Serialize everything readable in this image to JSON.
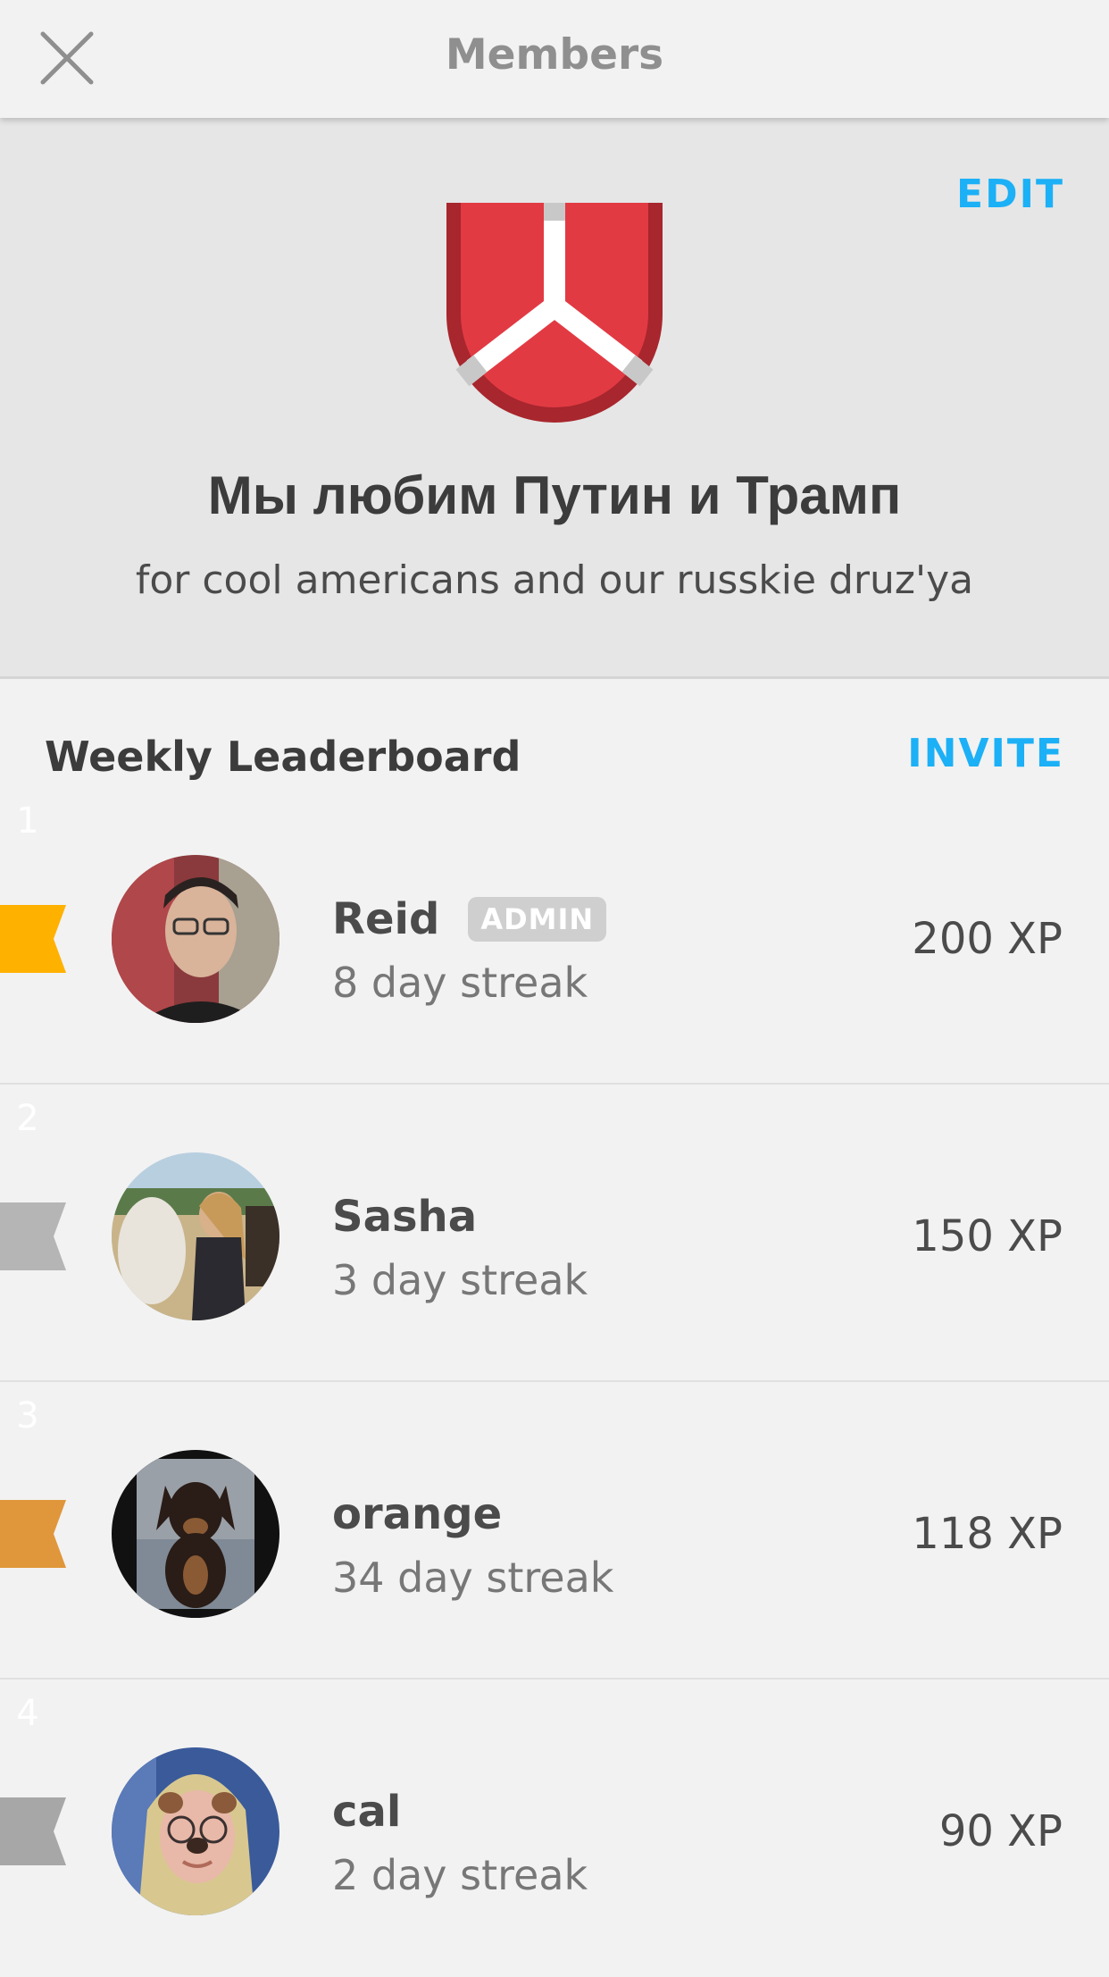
{
  "header": {
    "title": "Members",
    "close_icon": "close-icon"
  },
  "club": {
    "edit_label": "EDIT",
    "name": "Мы любим Путин и Трамп",
    "description": "for cool americans and our russkie druz'ya",
    "shield_icon": "shield-icon",
    "shield_colors": {
      "outer": "#a8262d",
      "inner": "#e23a43",
      "stripe": "#ffffff"
    }
  },
  "leaderboard": {
    "title": "Weekly Leaderboard",
    "invite_label": "INVITE",
    "members": [
      {
        "rank": "1",
        "name": "Reid",
        "badge": "ADMIN",
        "streak": "8 day streak",
        "xp": "200 XP",
        "rank_color": "#ffb100"
      },
      {
        "rank": "2",
        "name": "Sasha",
        "badge": "",
        "streak": "3 day streak",
        "xp": "150 XP",
        "rank_color": "#b5b5b5"
      },
      {
        "rank": "3",
        "name": "orange",
        "badge": "",
        "streak": "34 day streak",
        "xp": "118 XP",
        "rank_color": "#e0963a"
      },
      {
        "rank": "4",
        "name": "cal",
        "badge": "",
        "streak": "2 day streak",
        "xp": "90 XP",
        "rank_color": "#a7a7a7"
      }
    ]
  },
  "colors": {
    "accent": "#1cb0f6",
    "background": "#f2f2f2",
    "header_background": "#e6e6e6"
  }
}
